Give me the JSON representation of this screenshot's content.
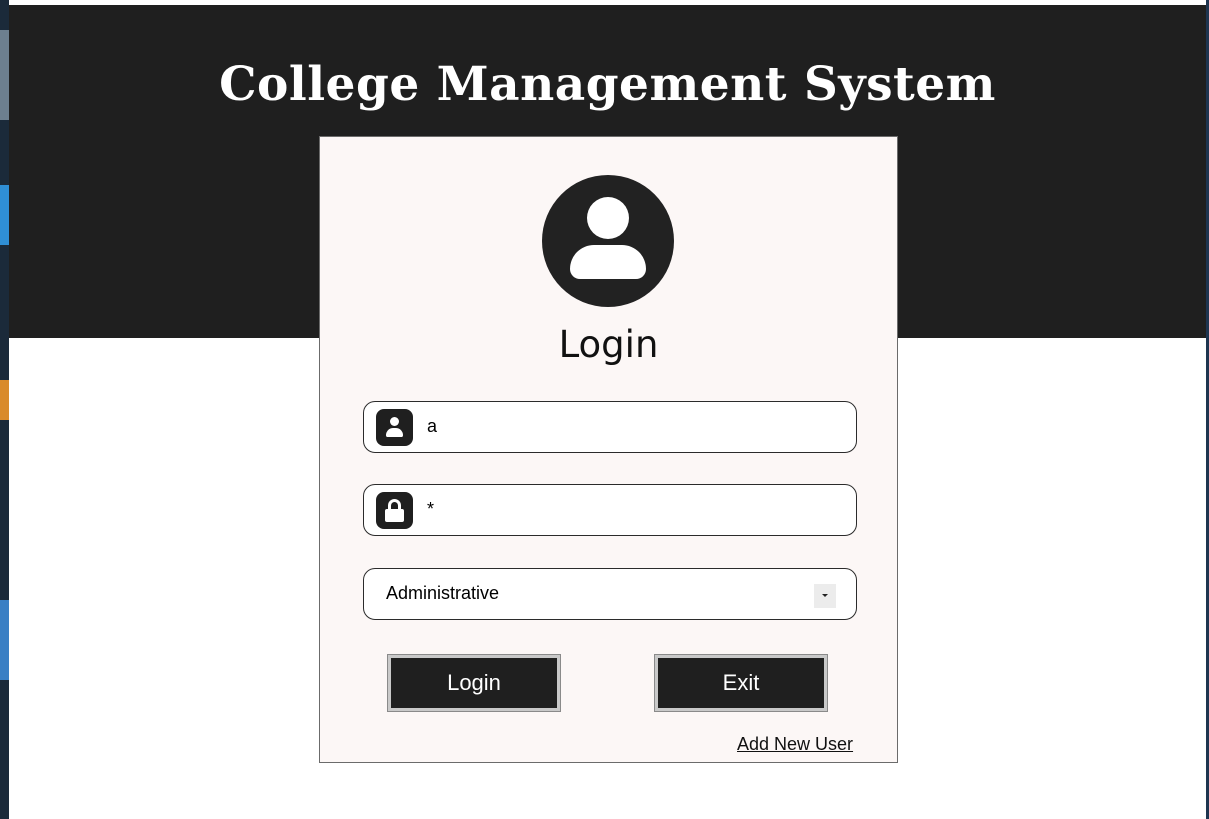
{
  "app": {
    "title": "College Management System"
  },
  "login": {
    "heading": "Login",
    "username_value": "a",
    "password_value": "*",
    "role_selected": "Administrative",
    "login_button": "Login",
    "exit_button": "Exit",
    "add_user_link": "Add New User"
  },
  "icons": {
    "avatar": "user-avatar-icon",
    "username": "user-icon",
    "password": "lock-icon",
    "dropdown": "chevron-down-icon"
  },
  "colors": {
    "header_background": "#1f1f1f",
    "panel_background": "#fcf7f6",
    "button_background": "#1f1f1f",
    "text_light": "#ffffff"
  }
}
